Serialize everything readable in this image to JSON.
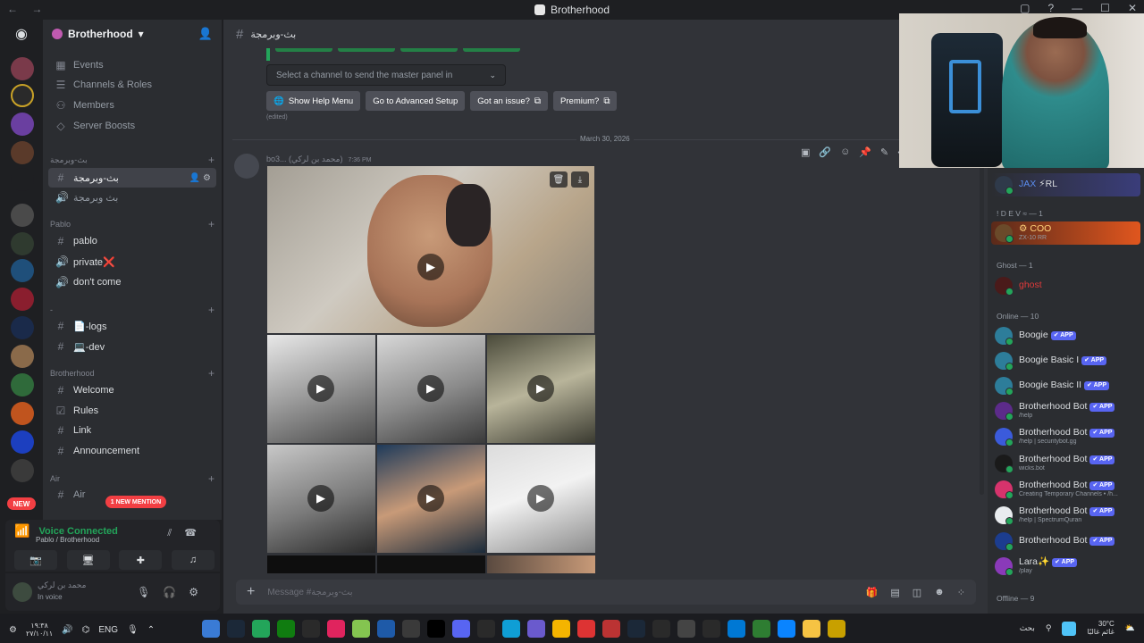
{
  "window": {
    "title": "Brotherhood",
    "nav": "← →",
    "controls": [
      "▢",
      "?",
      "—",
      "☐",
      "✕"
    ]
  },
  "server": {
    "name": "Brotherhood",
    "header_chevron": "▾"
  },
  "sidebar": {
    "top_items": [
      {
        "label": "Events",
        "icon": "calendar-icon"
      },
      {
        "label": "Channels & Roles",
        "icon": "list-icon"
      },
      {
        "label": "Members",
        "icon": "members-icon"
      },
      {
        "label": "Server Boosts",
        "icon": "boost-icon"
      }
    ],
    "category1": "بث-وبرمجة",
    "active_channel": "بث-وبرمجة",
    "channel2": "بث وبرمجة",
    "category_pablo": "Pablo",
    "pablo_channels": [
      "pablo",
      "private❌",
      "don't come"
    ],
    "category_blank": "-",
    "dev_channels": [
      "📄-logs",
      "💻-dev"
    ],
    "category_brotherhood": "Brotherhood",
    "brotherhood_channels": [
      "Welcome",
      "Rules",
      "Link",
      "Announcement"
    ],
    "category_air": "Air",
    "air_channel": "Air",
    "new_mention": "1 NEW MENTION",
    "new_badge": "NEW"
  },
  "voice": {
    "status": "Voice Connected",
    "location": "Pablo / Brotherhood"
  },
  "user": {
    "name": "محمد بن لركي",
    "status": "In voice"
  },
  "channel": {
    "name": "بث-وبرمجة"
  },
  "bot_panel": {
    "select_placeholder": "Select a channel to send the master panel in",
    "buttons": [
      "Show Help Menu",
      "Go to Advanced Setup",
      "Got an issue?",
      "Premium?"
    ],
    "edited": "(edited)"
  },
  "date_divider": "March 30, 2026",
  "message": {
    "author": "bo3... (محمد بن لركي)",
    "time": "7:36 PM"
  },
  "composer": {
    "placeholder": "Message #بث-وبرمجة"
  },
  "members": {
    "top_user": {
      "name": "JAX",
      "tag": "⚡RL"
    },
    "group_dev": "! D E V ≈ — 1",
    "dev_user": {
      "name": "COO",
      "sub": "ZX-10 RR"
    },
    "group_ghost": "Ghost — 1",
    "ghost_user": {
      "name": "ghost"
    },
    "group_online": "Online — 10",
    "online": [
      {
        "name": "Boogie",
        "sub": "",
        "color": "#2d7d9a"
      },
      {
        "name": "Boogie Basic I",
        "sub": "",
        "color": "#2d7d9a"
      },
      {
        "name": "Boogie Basic II",
        "sub": "",
        "color": "#2d7d9a"
      },
      {
        "name": "Brotherhood Bot",
        "sub": "/help",
        "color": "#5c2b8a"
      },
      {
        "name": "Brotherhood Bot",
        "sub": "/help | securitybot.gg",
        "color": "#3b5bdb"
      },
      {
        "name": "Brotherhood Bot",
        "sub": "wicks.bot",
        "color": "#1a1a1a"
      },
      {
        "name": "Brotherhood Bot",
        "sub": "Creating Temporary Channels • /h...",
        "color": "#d6336c"
      },
      {
        "name": "Brotherhood Bot",
        "sub": "/help | SpectrumQuran",
        "color": "#e9ecef"
      },
      {
        "name": "Brotherhood Bot",
        "sub": "",
        "color": "#1c3d8f"
      },
      {
        "name": "Lara✨",
        "sub": "/play",
        "color": "#8a3ab9"
      }
    ],
    "app_tag": "✔ APP",
    "group_offline": "Offline — 9"
  },
  "taskbar": {
    "time": "١٩:٣٨",
    "date": "٢٧/١٠/١١",
    "lang": "ENG",
    "search": "بحث",
    "weather_temp": "30°C",
    "weather_desc": "غائم غالبًا"
  }
}
